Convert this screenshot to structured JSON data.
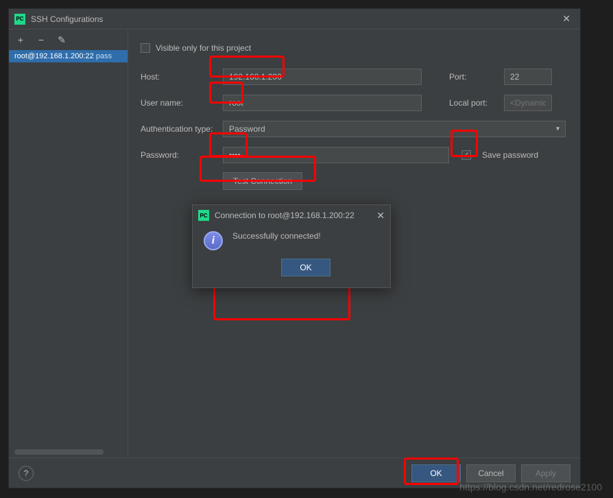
{
  "title": "SSH Configurations",
  "app_icon_text": "PC",
  "toolbar": {
    "add": "+",
    "remove": "−",
    "edit": "✎"
  },
  "config_list": [
    {
      "name": "root@192.168.1.200:22",
      "suffix": "pass"
    }
  ],
  "form": {
    "visible_only_label": "Visible only for this project",
    "visible_only_checked": false,
    "host_label": "Host:",
    "host_value": "192.168.1.200",
    "port_label": "Port:",
    "port_value": "22",
    "user_label": "User name:",
    "user_value": "root",
    "local_port_label": "Local port:",
    "local_port_placeholder": "<Dynamic>",
    "auth_label": "Authentication type:",
    "auth_value": "Password",
    "password_label": "Password:",
    "password_value": "••••",
    "save_password_label": "Save password",
    "save_password_checked": true,
    "test_connection": "Test Connection"
  },
  "modal": {
    "title": "Connection to root@192.168.1.200:22",
    "message": "Successfully connected!",
    "ok": "OK"
  },
  "footer": {
    "ok": "OK",
    "cancel": "Cancel",
    "apply": "Apply",
    "help": "?"
  },
  "watermark": "https://blog.csdn.net/redrose2100"
}
